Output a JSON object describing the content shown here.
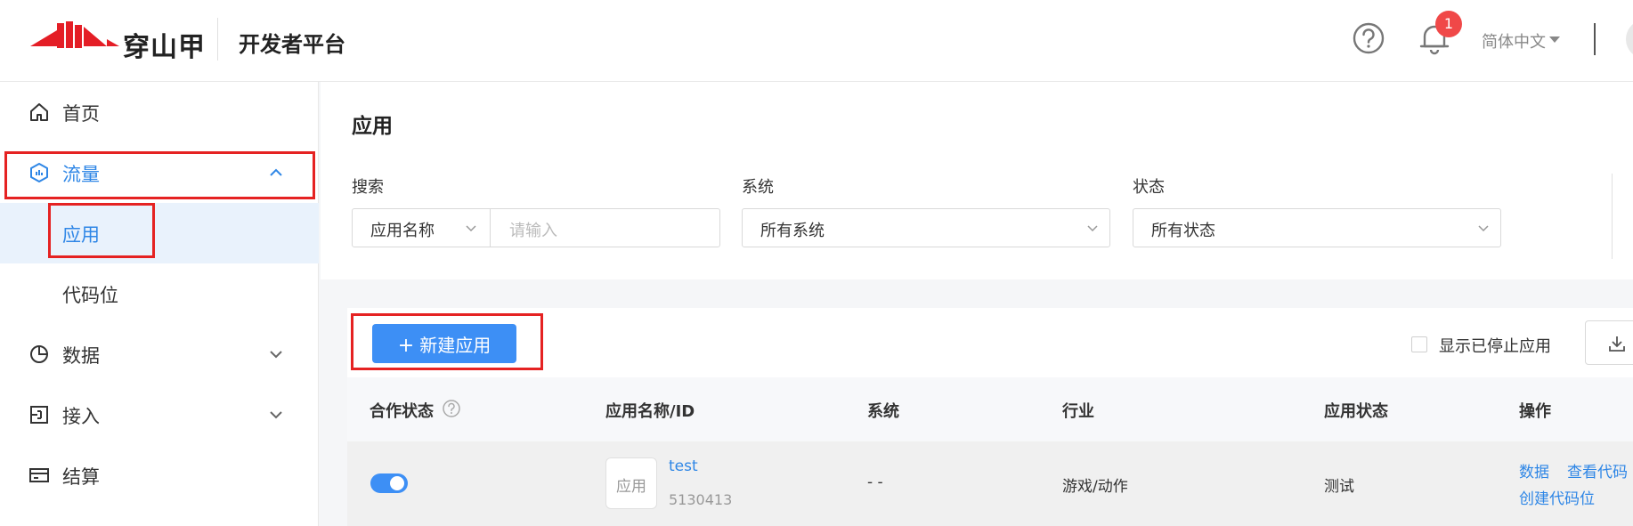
{
  "header": {
    "logo_text": "穿山甲",
    "platform_title": "开发者平台",
    "notification_count": "1",
    "language": "简体中文"
  },
  "sidebar": {
    "items": [
      {
        "label": "首页"
      },
      {
        "label": "流量"
      },
      {
        "label": "应用"
      },
      {
        "label": "代码位"
      },
      {
        "label": "数据"
      },
      {
        "label": "接入"
      },
      {
        "label": "结算"
      }
    ]
  },
  "filters": {
    "page_title": "应用",
    "search_label": "搜索",
    "search_type": "应用名称",
    "search_placeholder": "请输入",
    "system_label": "系统",
    "system_value": "所有系统",
    "status_label": "状态",
    "status_value": "所有状态"
  },
  "toolbar": {
    "new_app_label": "新建应用",
    "show_stopped_label": "显示已停止应用"
  },
  "table": {
    "columns": [
      "合作状态",
      "应用名称/ID",
      "系统",
      "行业",
      "应用状态",
      "操作"
    ],
    "rows": [
      {
        "thumb": "应用",
        "name": "test",
        "id": "5130413",
        "system": "- -",
        "industry": "游戏/动作",
        "status": "测试",
        "actions": [
          "数据",
          "查看代码",
          "创建代码位"
        ]
      }
    ]
  },
  "colors": {
    "accent": "#3d8ff5",
    "link": "#2e86e6",
    "highlight_box": "#e52222",
    "badge": "#f04848"
  }
}
